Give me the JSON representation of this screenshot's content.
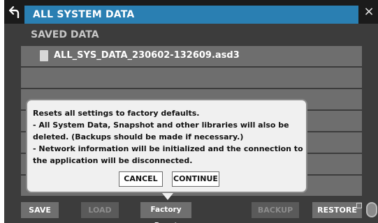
{
  "window": {
    "title": "ALL SYSTEM DATA",
    "close_glyph": "×",
    "back_icon": "back-arrow-icon"
  },
  "saved_data": {
    "section_label": "SAVED DATA",
    "items": [
      {
        "name": "ALL_SYS_DATA_230602-132609.asd3",
        "icon": "file-icon"
      }
    ]
  },
  "dialog": {
    "lines": [
      "Resets all settings to factory defaults.",
      "- All System Data, Snapshot and other libraries will also be",
      "deleted. (Backups should be made if necessary.)",
      "- Network information will be initialized and the connection to",
      "the application will be disconnected."
    ],
    "cancel_label": "CANCEL",
    "continue_label": "CONTINUE"
  },
  "bottom_bar": {
    "save_label": "SAVE",
    "load_label": "LOAD",
    "factory_reset_label": "Factory Reset",
    "backup_label": "BACKUP",
    "restore_label": "RESTORE"
  },
  "colors": {
    "title_bar": "#2a7fb2",
    "list_row": "#6e6e6e",
    "background": "#3c3c3c",
    "dialog_bg": "#f0f0f0"
  }
}
